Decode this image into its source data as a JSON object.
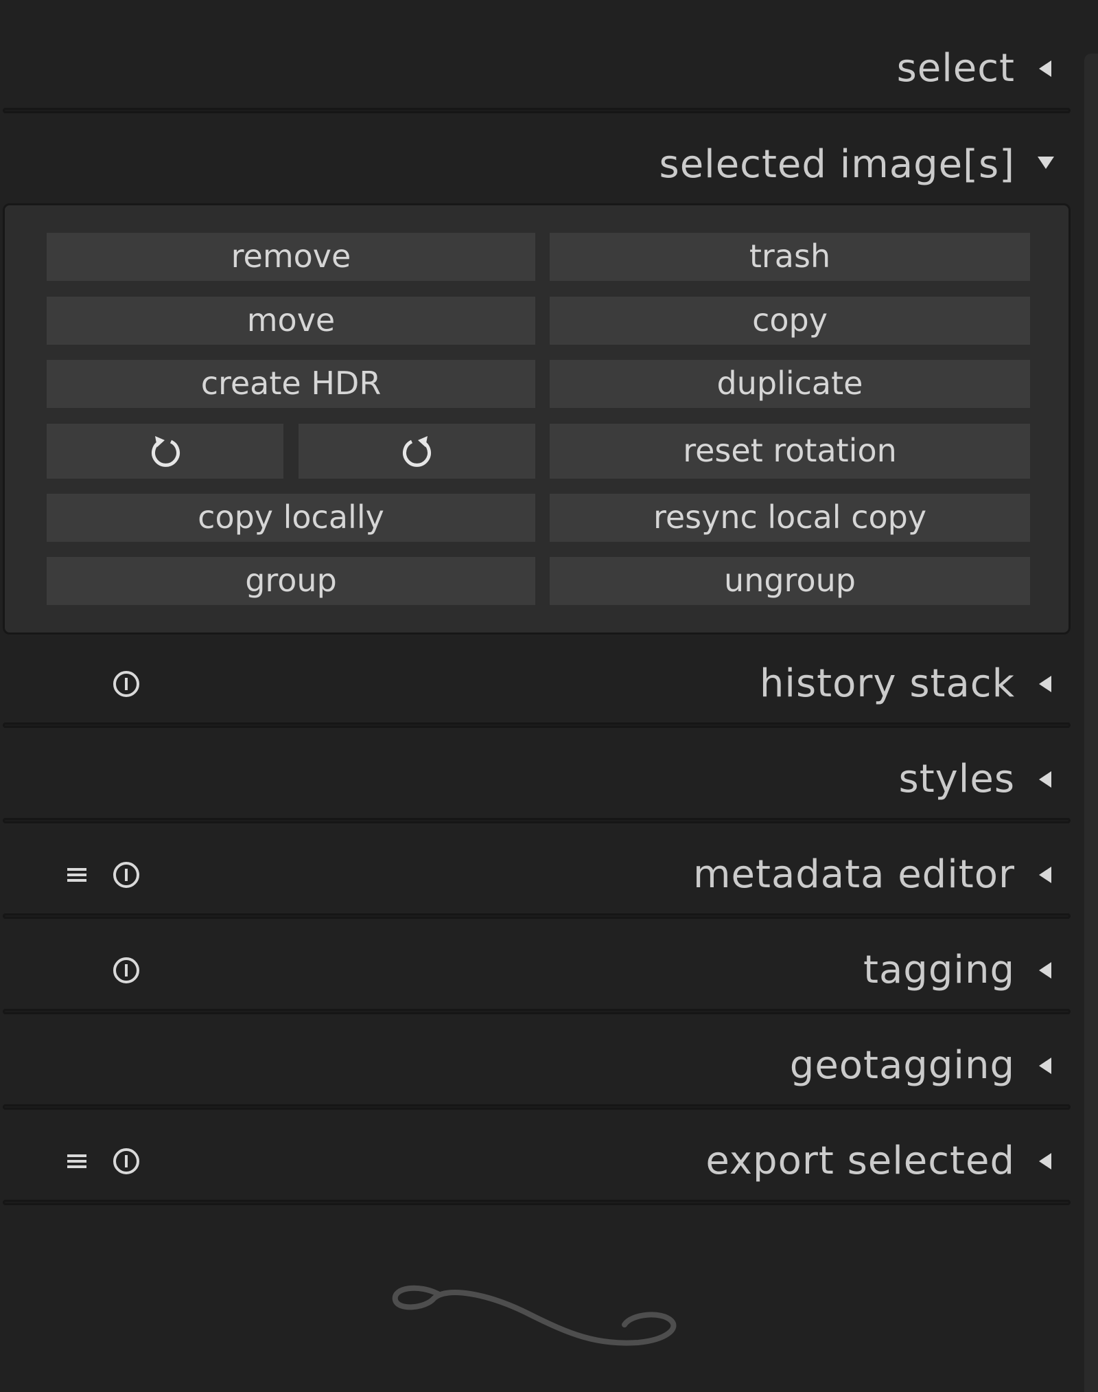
{
  "modules": {
    "select": {
      "label": "select",
      "arrow": "collapsed-arrow-icon"
    },
    "selected_images": {
      "label": "selected image[s]",
      "arrow": "expanded-arrow-icon",
      "buttons": {
        "remove": "remove",
        "trash": "trash",
        "move": "move",
        "copy": "copy",
        "create_hdr": "create HDR",
        "duplicate": "duplicate",
        "rotate_ccw": "rotate-ccw-icon",
        "rotate_cw": "rotate-cw-icon",
        "reset_rotation": "reset rotation",
        "copy_locally": "copy locally",
        "resync_local_copy": "resync local copy",
        "group": "group",
        "ungroup": "ungroup"
      }
    },
    "history_stack": {
      "label": "history stack",
      "icons": [
        "reset-icon"
      ]
    },
    "styles": {
      "label": "styles"
    },
    "metadata_editor": {
      "label": "metadata editor",
      "icons": [
        "presets-icon",
        "reset-icon"
      ]
    },
    "tagging": {
      "label": "tagging",
      "icons": [
        "reset-icon"
      ]
    },
    "geotagging": {
      "label": "geotagging"
    },
    "export_selected": {
      "label": "export selected",
      "icons": [
        "presets-icon",
        "reset-icon"
      ]
    }
  },
  "colors": {
    "panel_bg": "#212121",
    "expanded_bg": "#2d2d2d",
    "button_bg": "#3c3c3c",
    "text": "#cbcbcb"
  },
  "decoration": "flourish-ornament"
}
